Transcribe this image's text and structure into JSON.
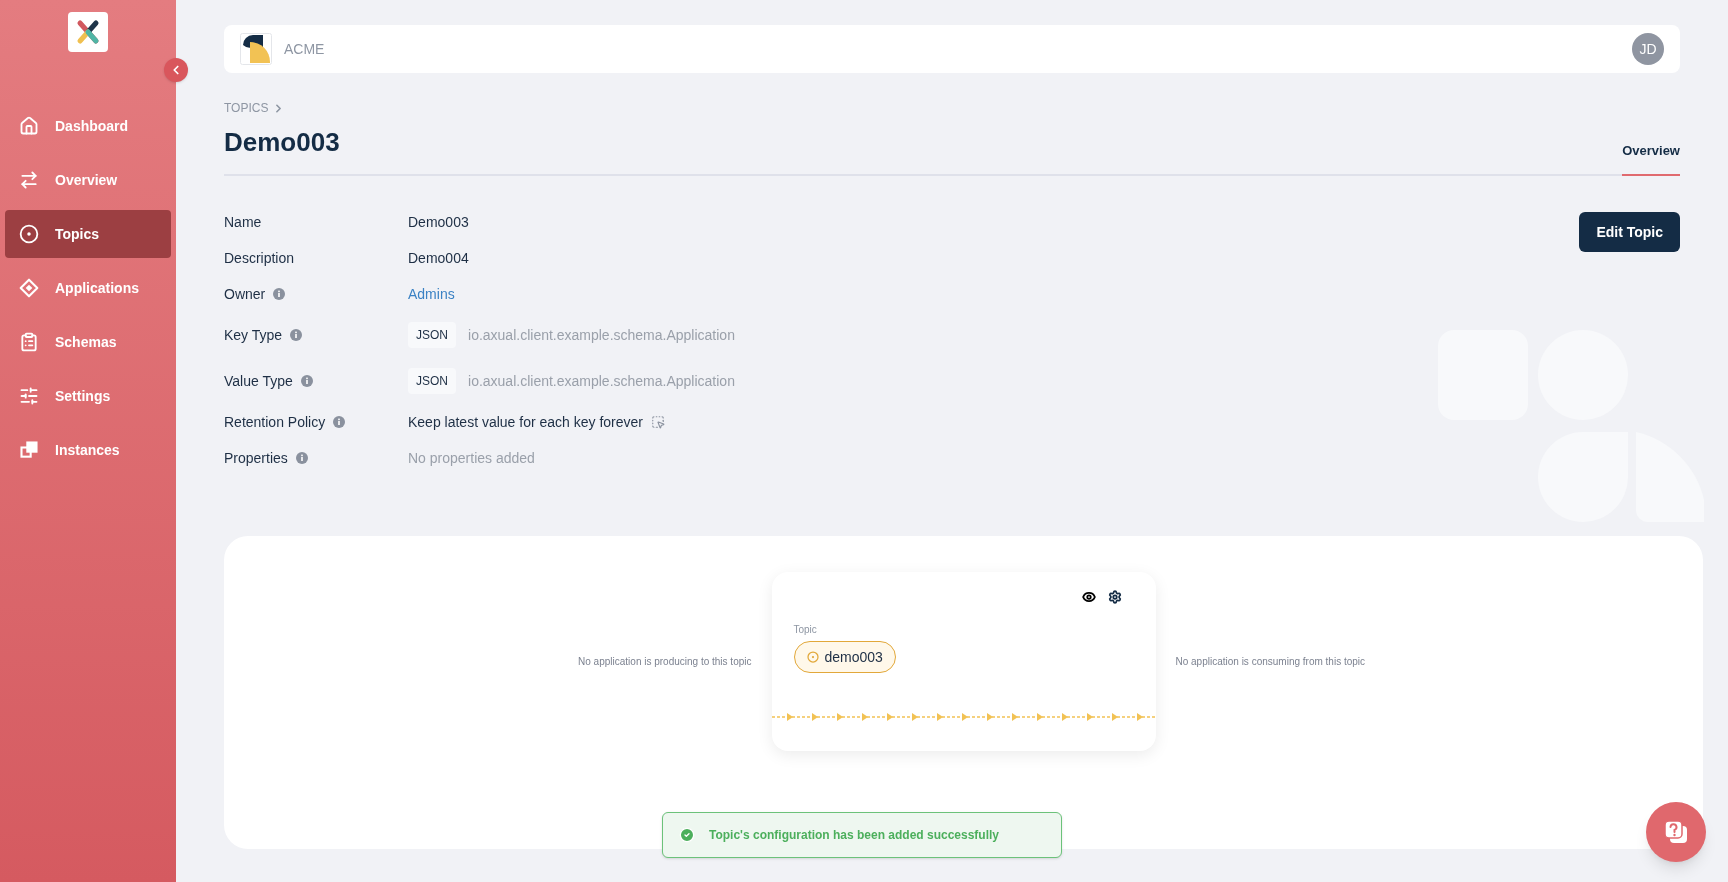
{
  "sidebar": {
    "items": [
      {
        "kind": "home",
        "label": "Dashboard",
        "selected": false
      },
      {
        "kind": "arrows",
        "label": "Overview",
        "selected": false
      },
      {
        "kind": "topic",
        "label": "Topics",
        "selected": true
      },
      {
        "kind": "diamond",
        "label": "Applications",
        "selected": false
      },
      {
        "kind": "clipboard",
        "label": "Schemas",
        "selected": false
      },
      {
        "kind": "sliders",
        "label": "Settings",
        "selected": false
      },
      {
        "kind": "squares",
        "label": "Instances",
        "selected": false
      }
    ]
  },
  "header": {
    "org": "ACME",
    "avatar": "JD"
  },
  "breadcrumb": [
    "TOPICS"
  ],
  "title": "Demo003",
  "tabs": [
    {
      "label": "Overview",
      "selected": true
    }
  ],
  "details": [
    {
      "label": "Name",
      "info": false,
      "kind": "text",
      "value": "Demo003"
    },
    {
      "label": "Description",
      "info": false,
      "kind": "text",
      "value": "Demo004"
    },
    {
      "label": "Owner",
      "info": true,
      "kind": "link",
      "value": "Admins"
    },
    {
      "label": "Key Type",
      "info": true,
      "kind": "type",
      "badge": "JSON",
      "value": "io.axual.client.example.schema.Application"
    },
    {
      "label": "Value Type",
      "info": true,
      "kind": "type",
      "badge": "JSON",
      "value": "io.axual.client.example.schema.Application"
    },
    {
      "label": "Retention Policy",
      "info": true,
      "kind": "text_icon",
      "value": "Keep latest value for each key forever"
    },
    {
      "label": "Properties",
      "info": true,
      "kind": "muted",
      "value": "No properties added"
    }
  ],
  "edit_button": "Edit Topic",
  "flow": {
    "producers": "No application is producing to this topic",
    "consumers": "No application is consuming from this topic",
    "node_label": "Topic",
    "topic": "demo003"
  },
  "toast": "Topic's configuration has been added successfully"
}
